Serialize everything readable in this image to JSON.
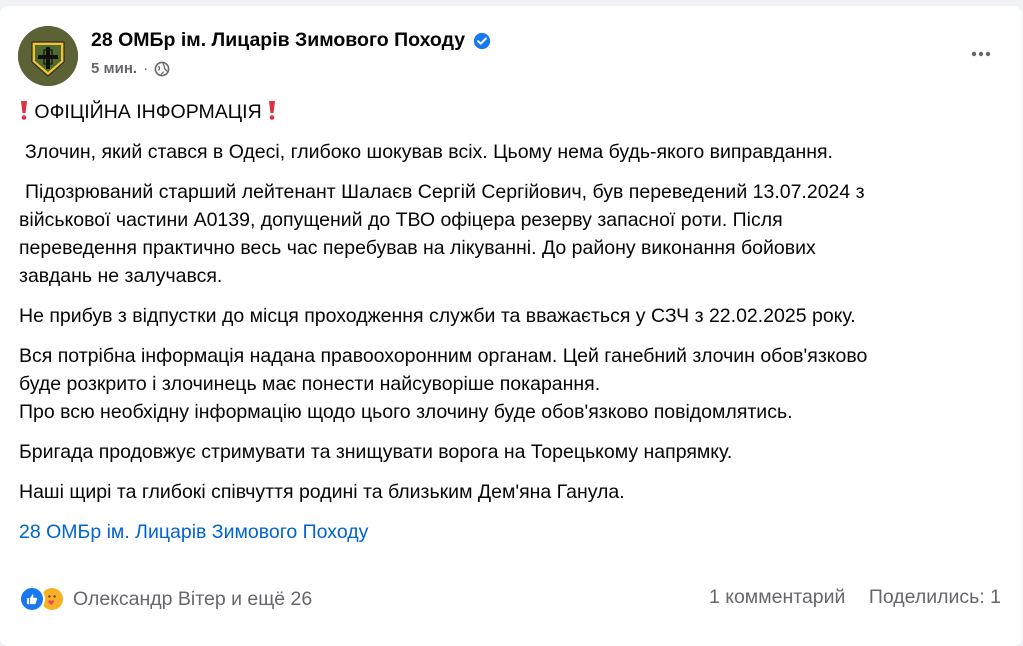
{
  "post": {
    "author": "28 ОМБр ім. Лицарів Зимового Походу",
    "time": "5 мин.",
    "separator": "·",
    "verified_icon": "verified-badge-icon",
    "privacy_icon": "globe-icon",
    "more_icon": "more-options-icon"
  },
  "content": {
    "heading": "ОФІЦІЙНА ІНФОРМАЦІЯ",
    "p1": "Злочин, який стався в Одесі, глибоко шокував всіх. Цьому нема будь-якого виправдання.",
    "p2_l1": "Підозрюваний старший лейтенант Шалаєв Сергій Сергійович, був переведений 13.07.2024 з",
    "p2_l2": "військової частини А0139, допущений до ТВО офіцера резерву запасної роти. Після",
    "p2_l3": "переведення практично весь час перебував на лікуванні. До району виконання бойових",
    "p2_l4": "завдань не залучався.",
    "p3": "Не прибув з відпустки до місця проходження служби та вважається у СЗЧ з 22.02.2025 року.",
    "p4_l1": "Вся потрібна інформація надана правоохоронним органам. Цей ганебний злочин обов'язково",
    "p4_l2": "буде розкрито і злочинець має понести найсуворіше покарання.",
    "p4_l3": "Про всю необхідну інформацію щодо цього злочину буде обов'язково повідомлятись.",
    "p5": "Бригада продовжує стримувати та знищувати ворога на Торецькому напрямку.",
    "p6": "Наші щирі та глибокі співчуття родині та близьким Дем'яна Ганула.",
    "link": "28 ОМБр ім. Лицарів Зимового Походу"
  },
  "footer": {
    "reactions": [
      "like-icon",
      "care-icon"
    ],
    "reactors": "Олександр Вітер и ещё 26",
    "comments": "1 комментарий",
    "shares": "Поделились: 1"
  },
  "colors": {
    "link": "#0064d1",
    "secondary": "#65676b",
    "like": "#1877f2",
    "exclamation": "#dd2e44",
    "avatar_bg": "#5d6136"
  }
}
